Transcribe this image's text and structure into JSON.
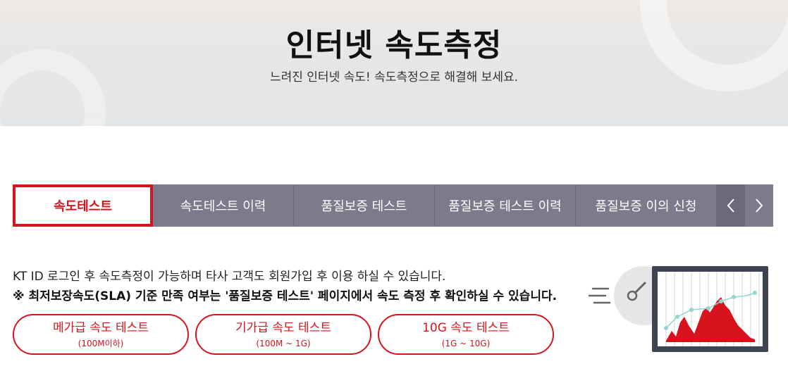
{
  "hero": {
    "title": "인터넷 속도측정",
    "subtitle": "느려진 인터넷 속도! 속도측정으로 해결해 보세요."
  },
  "tabs": [
    {
      "label": "속도테스트",
      "active": true
    },
    {
      "label": "속도테스트 이력",
      "active": false
    },
    {
      "label": "품질보증 테스트",
      "active": false
    },
    {
      "label": "품질보증 테스트 이력",
      "active": false
    },
    {
      "label": "품질보증 이의 신청",
      "active": false
    }
  ],
  "tab_nav": {
    "prev_icon": "chevron-left-icon",
    "next_icon": "chevron-right-icon"
  },
  "info": {
    "line1": "KT ID 로그인 후 속도측정이 가능하며 타사 고객도 회원가입 후 이용 하실 수 있습니다.",
    "line2": "※ 최저보장속도(SLA) 기준 만족 여부는 '품질보증 테스트' 페이지에서 속도 측정 후 확인하실 수 있습니다."
  },
  "speed_buttons": [
    {
      "label": "메가급 속도 테스트",
      "range": "(100M이하)"
    },
    {
      "label": "기가급 속도 테스트",
      "range": "(100M ~ 1G)"
    },
    {
      "label": "10G 속도 테스트",
      "range": "(1G ~ 10G)"
    }
  ],
  "colors": {
    "accent": "#d7131e",
    "tab_bg": "#7b7b8c",
    "tab_arrow_bg": "#6a6a7a"
  }
}
